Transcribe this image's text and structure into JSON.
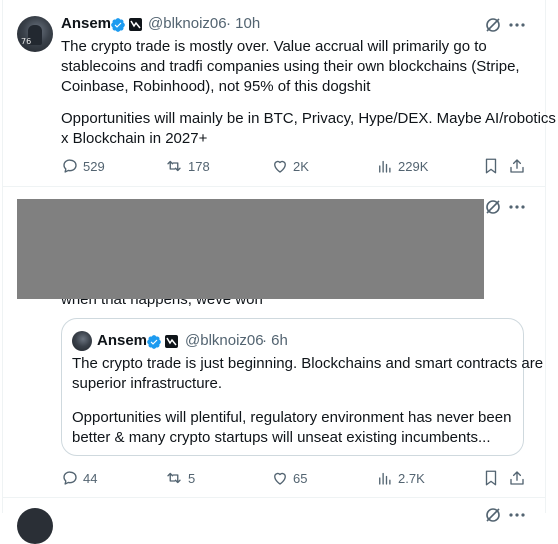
{
  "tweet1": {
    "author_name": "Ansem",
    "handle": "@blknoiz06",
    "time": "· 10h",
    "avatar_caption": "76",
    "text_lines": [
      "The crypto trade is mostly over. Value accrual will primarily go to",
      "stablecoins and tradfi companies using their own blockchains (Stripe,",
      "Coinbase, Robinhood), not 95% of this dogshit",
      "",
      "Opportunities will mainly be in BTC, Privacy, Hype/DEX. Maybe AI/robotics",
      "x Blockchain in 2027+"
    ],
    "replies": "529",
    "reposts": "178",
    "likes": "2K",
    "views": "229K"
  },
  "tweet2": {
    "visible_fragment": "when that happens, weve won",
    "replies": "44",
    "reposts": "5",
    "likes": "65",
    "views": "2.7K"
  },
  "quote": {
    "author_name": "Ansem",
    "handle": "@blknoiz06",
    "time": "· 6h",
    "text_lines": [
      "The crypto trade is just beginning. Blockchains and smart contracts are",
      "superior infrastructure.",
      "",
      "Opportunities will plentiful, regulatory environment has never been",
      "better & many crypto startups will unseat existing incumbents..."
    ]
  },
  "icons": {
    "verified": "verified-badge-icon",
    "affiliate": "affiliate-badge-icon",
    "grok": "grok-icon",
    "more": "more-icon",
    "reply": "reply-icon",
    "repost": "repost-icon",
    "like": "like-icon",
    "views": "views-icon",
    "bookmark": "bookmark-icon",
    "share": "share-icon"
  },
  "colors": {
    "text": "#0f1419",
    "secondary": "#536471",
    "verified": "#1d9bf0",
    "border": "#cfd9de",
    "redaction": "#808080"
  }
}
